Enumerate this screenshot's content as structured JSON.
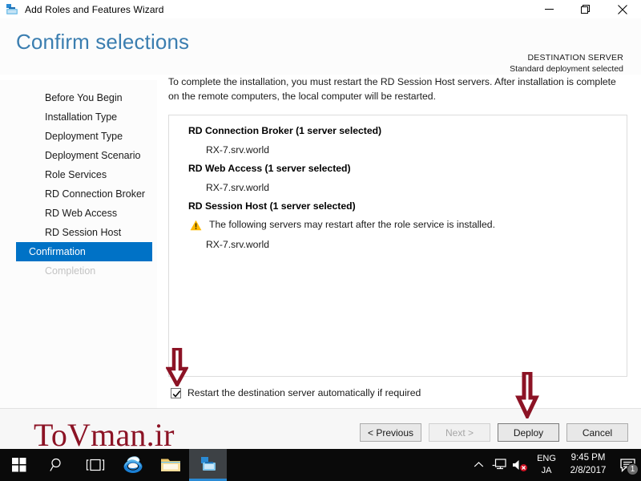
{
  "window": {
    "title": "Add Roles and Features Wizard",
    "icon": "server-manager-toolbox-icon",
    "minimize_label": "Minimize",
    "restore_label": "Restore",
    "close_label": "Close"
  },
  "header": {
    "page_title": "Confirm selections",
    "destination_server_label": "DESTINATION SERVER",
    "destination_server_value": "Standard deployment selected",
    "accent_color": "#3b7eb0"
  },
  "sidebar": {
    "items": [
      {
        "label": "Before You Begin",
        "state": "normal"
      },
      {
        "label": "Installation Type",
        "state": "normal"
      },
      {
        "label": "Deployment Type",
        "state": "normal"
      },
      {
        "label": "Deployment Scenario",
        "state": "normal"
      },
      {
        "label": "Role Services",
        "state": "normal"
      },
      {
        "label": "RD Connection Broker",
        "state": "normal"
      },
      {
        "label": "RD Web Access",
        "state": "normal"
      },
      {
        "label": "RD Session Host",
        "state": "normal"
      },
      {
        "label": "Confirmation",
        "state": "active"
      },
      {
        "label": "Completion",
        "state": "disabled"
      }
    ],
    "active_color": "#0072c6"
  },
  "main": {
    "intro": "To complete the installation, you must restart the RD Session Host servers. After installation is complete on the remote computers, the local computer will be restarted.",
    "groups": [
      {
        "heading": "RD Connection Broker  (1 server selected)",
        "warning": null,
        "servers": [
          "RX-7.srv.world"
        ]
      },
      {
        "heading": "RD Web Access  (1 server selected)",
        "warning": null,
        "servers": [
          "RX-7.srv.world"
        ]
      },
      {
        "heading": "RD Session Host  (1 server selected)",
        "warning": "The following servers may restart after the role service is installed.",
        "servers": [
          "RX-7.srv.world"
        ]
      }
    ],
    "warning_icon": "warning-triangle-icon",
    "warning_color": "#ffb900"
  },
  "options": {
    "restart_checkbox_label": "Restart the destination server automatically if required",
    "restart_checkbox_checked": true
  },
  "footer": {
    "buttons": [
      {
        "label": "< Previous",
        "state": "normal"
      },
      {
        "label": "Next >",
        "state": "disabled"
      },
      {
        "label": "Deploy",
        "state": "focus"
      },
      {
        "label": "Cancel",
        "state": "normal"
      }
    ]
  },
  "annotations": {
    "arrow_color": "#8c1325",
    "arrow_1_target": "restart-checkbox",
    "arrow_2_target": "deploy-button",
    "watermark": "ToVman.ir"
  },
  "taskbar": {
    "items": [
      {
        "name": "start-button",
        "icon": "windows-logo-icon",
        "active": false
      },
      {
        "name": "search-button",
        "icon": "search-icon",
        "active": false
      },
      {
        "name": "task-view-button",
        "icon": "task-view-icon",
        "active": false
      },
      {
        "name": "internet-explorer-button",
        "icon": "internet-explorer-icon",
        "active": false
      },
      {
        "name": "file-explorer-button",
        "icon": "folder-icon",
        "active": false
      },
      {
        "name": "server-manager-button",
        "icon": "server-manager-icon",
        "active": true
      }
    ],
    "tray": {
      "show_hidden_icon": "chevron-up-icon",
      "network_icon": "network-icon",
      "volume_icon": "volume-muted-icon",
      "language_line_1": "ENG",
      "language_line_2": "JA",
      "clock_time": "9:45 PM",
      "clock_date": "2/8/2017",
      "notification_icon": "notification-icon",
      "notification_count": "1"
    }
  }
}
